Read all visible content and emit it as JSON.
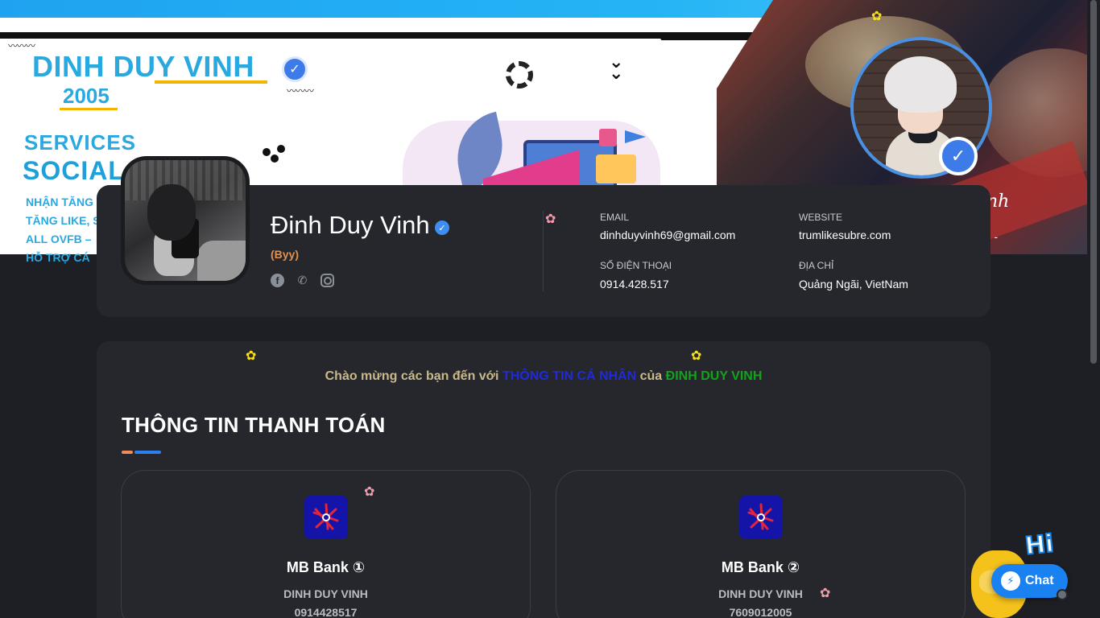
{
  "cover": {
    "name": "DINH DUY VINH",
    "year": "2005",
    "services": "SERVICES",
    "social": "SOCIAL",
    "lines": [
      "NHẬN TĂNG",
      "TĂNG LIKE, S",
      "ALL OVFB –",
      "HỖ TRỢ CÁ"
    ],
    "art_text": "nh",
    "art_dash": "- -"
  },
  "profile": {
    "name": "Đinh Duy Vinh",
    "nickname": "(Byy)",
    "social_icons": [
      "facebook-icon",
      "phone-icon",
      "instagram-icon"
    ],
    "email_label": "EMAIL",
    "email": "dinhduyvinh69@gmail.com",
    "website_label": "WEBSITE",
    "website": "trumlikesubre.com",
    "phone_label": "SỐ ĐIỆN THOẠI",
    "phone": "0914.428.517",
    "address_label": "ĐỊA CHỈ",
    "address": "Quảng Ngãi, VietNam"
  },
  "welcome": {
    "prefix": "Chào mừng các bạn đến với",
    "highlight": "THÔNG TIN CÁ NHÂN",
    "middle": "của",
    "name": "ĐINH DUY VINH"
  },
  "payment": {
    "title": "THÔNG TIN THANH TOÁN",
    "banks": [
      {
        "name": "MB Bank ①",
        "owner": "DINH DUY VINH",
        "number": "0914428517"
      },
      {
        "name": "MB Bank ②",
        "owner": "DINH DUY VINH",
        "number": "7609012005"
      }
    ]
  },
  "chat": {
    "label": "Chat",
    "greeting": "Hi"
  },
  "colors": {
    "background": "#1e1f24",
    "card": "#25272d",
    "accent_blue": "#2b7ff0",
    "accent_orange": "#f08a5a",
    "nickname": "#e2904d",
    "bank_logo": "#1414a8"
  }
}
